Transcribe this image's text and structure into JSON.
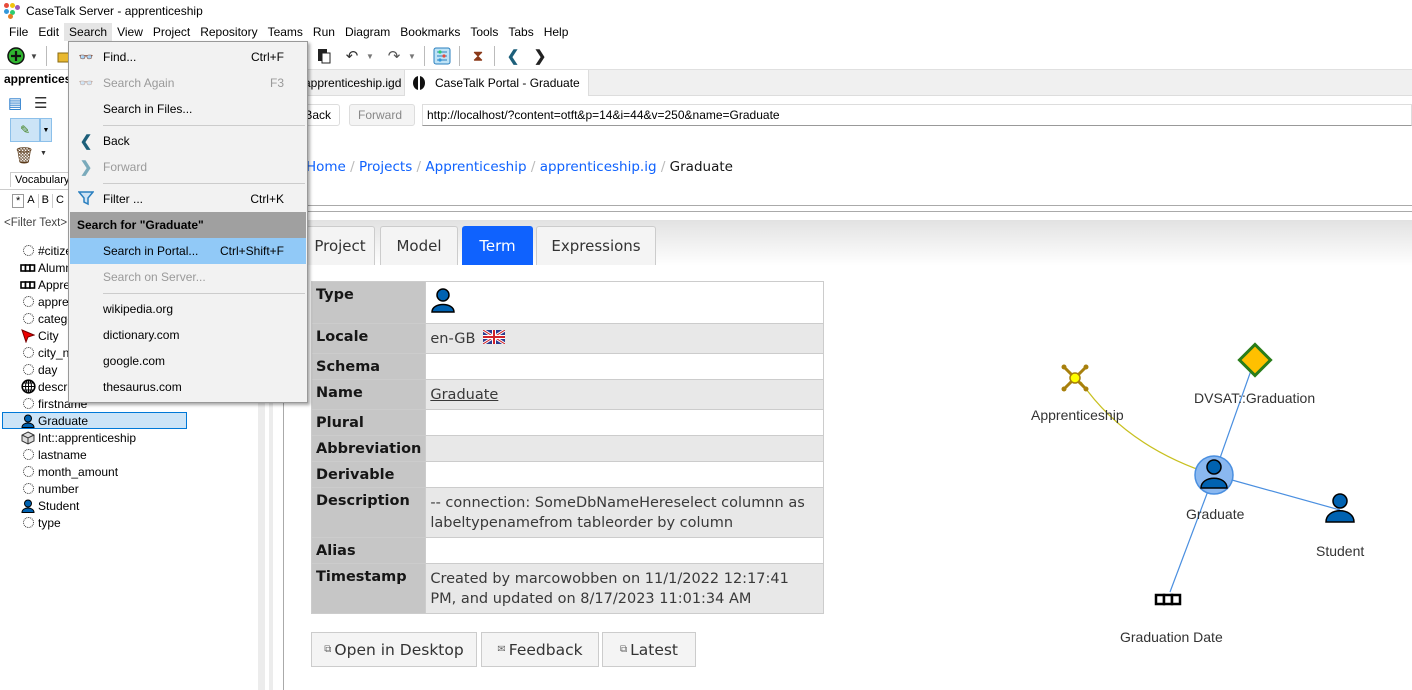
{
  "window": {
    "title": "CaseTalk Server - apprenticeship"
  },
  "menubar": [
    "File",
    "Edit",
    "Search",
    "View",
    "Project",
    "Repository",
    "Teams",
    "Run",
    "Diagram",
    "Bookmarks",
    "Tools",
    "Tabs",
    "Help"
  ],
  "menubar_active": "Search",
  "left_panel": {
    "project_title": "apprenticeship",
    "tab_label": "Vocabulary",
    "alpha_tabs": [
      "*",
      "A",
      "B",
      "C"
    ],
    "filter_placeholder": "<Filter Text>",
    "items": [
      {
        "label": "#citizen",
        "icon": "dotted-circle-icon"
      },
      {
        "label": "Alumni",
        "icon": "chain-icon"
      },
      {
        "label": "Apprentice",
        "icon": "chain-icon"
      },
      {
        "label": "apprenticeship",
        "icon": "dotted-circle-icon"
      },
      {
        "label": "category",
        "icon": "dotted-circle-icon"
      },
      {
        "label": "City",
        "icon": "red-arrow-icon"
      },
      {
        "label": "city_name",
        "icon": "dotted-circle-icon"
      },
      {
        "label": "day",
        "icon": "dotted-circle-icon"
      },
      {
        "label": "description",
        "icon": "globe-icon"
      },
      {
        "label": "firstname",
        "icon": "dotted-circle-icon"
      },
      {
        "label": "Graduate",
        "icon": "person-icon",
        "selected": true
      },
      {
        "label": "Int::apprenticeship",
        "icon": "cube-icon"
      },
      {
        "label": "lastname",
        "icon": "dotted-circle-icon"
      },
      {
        "label": "month_amount",
        "icon": "dotted-circle-icon"
      },
      {
        "label": "number",
        "icon": "dotted-circle-icon"
      },
      {
        "label": "Student",
        "icon": "person-icon"
      },
      {
        "label": "type",
        "icon": "dotted-circle-icon"
      }
    ]
  },
  "search_menu": {
    "items": [
      {
        "label": "Find...",
        "shortcut": "Ctrl+F",
        "icon": "binoculars-icon",
        "disabled": false
      },
      {
        "label": "Search Again",
        "shortcut": "F3",
        "icon": "binoculars-icon",
        "disabled": true
      },
      {
        "label": "Search in Files...",
        "shortcut": "",
        "icon": "",
        "disabled": false
      },
      {
        "label": "Back",
        "shortcut": "",
        "icon": "chevron-left-icon",
        "disabled": false
      },
      {
        "label": "Forward",
        "shortcut": "",
        "icon": "chevron-right-icon",
        "disabled": true
      },
      {
        "label": "Filter ...",
        "shortcut": "Ctrl+K",
        "icon": "filter-icon",
        "disabled": false
      },
      {
        "label": "Search for \"Graduate\"",
        "header": true
      },
      {
        "label": "Search in Portal...",
        "shortcut": "Ctrl+Shift+F",
        "hover": true
      },
      {
        "label": "Search on Server...",
        "shortcut": "",
        "disabled": true
      },
      {
        "label": "wikipedia.org"
      },
      {
        "label": "dictionary.com"
      },
      {
        "label": "google.com"
      },
      {
        "label": "thesaurus.com"
      }
    ]
  },
  "doc_tabs": [
    {
      "label": "apprenticeship.igd",
      "active": false
    },
    {
      "label": "CaseTalk Portal - Graduate",
      "active": true
    }
  ],
  "nav": {
    "back_label": "Back",
    "forward_label": "Forward",
    "url": "http://localhost/?content=otft&p=14&i=44&v=250&name=Graduate"
  },
  "portal": {
    "breadcrumb": [
      "Home",
      "Projects",
      "Apprenticeship",
      "apprenticeship.ig",
      "Graduate"
    ],
    "tabs": [
      "Project",
      "Model",
      "Term",
      "Expressions"
    ],
    "active_tab": "Term",
    "properties": [
      {
        "key": "Type",
        "value": "",
        "icon": "person-icon"
      },
      {
        "key": "Locale",
        "value": "en-GB",
        "icon": "uk-flag-icon"
      },
      {
        "key": "Schema",
        "value": ""
      },
      {
        "key": "Name",
        "value": "Graduate",
        "link": true
      },
      {
        "key": "Plural",
        "value": ""
      },
      {
        "key": "Abbreviation",
        "value": ""
      },
      {
        "key": "Derivable",
        "value": ""
      },
      {
        "key": "Description",
        "value": "-- connection: SomeDbNameHereselect columnn as labeltypenamefrom tableorder by column"
      },
      {
        "key": "Alias",
        "value": ""
      },
      {
        "key": "Timestamp",
        "value": "Created by marcowobben on 11/1/2022 12:17:41 PM, and updated on 8/17/2023 11:01:34 AM"
      }
    ],
    "buttons": [
      {
        "label": "Open in Desktop",
        "icon": "external-link-icon"
      },
      {
        "label": "Feedback",
        "icon": "mail-icon"
      },
      {
        "label": "Latest",
        "icon": "external-link-icon"
      }
    ],
    "graph": {
      "nodes": [
        {
          "id": "graduate",
          "label": "Graduate",
          "type": "person",
          "center": true
        },
        {
          "id": "apprenticeship",
          "label": "Apprenticeship",
          "type": "fact-type"
        },
        {
          "id": "dvsat",
          "label": "DVSAT::Graduation",
          "type": "diamond"
        },
        {
          "id": "student",
          "label": "Student",
          "type": "person"
        },
        {
          "id": "graddate",
          "label": "Graduation Date",
          "type": "label-type"
        }
      ],
      "edges": [
        {
          "from": "graduate",
          "to": "apprenticeship",
          "color": "#c8c020"
        },
        {
          "from": "graduate",
          "to": "dvsat",
          "color": "#4a8fe0"
        },
        {
          "from": "graduate",
          "to": "student",
          "color": "#4a8fe0"
        },
        {
          "from": "graduate",
          "to": "graddate",
          "color": "#4a8fe0"
        }
      ]
    }
  }
}
